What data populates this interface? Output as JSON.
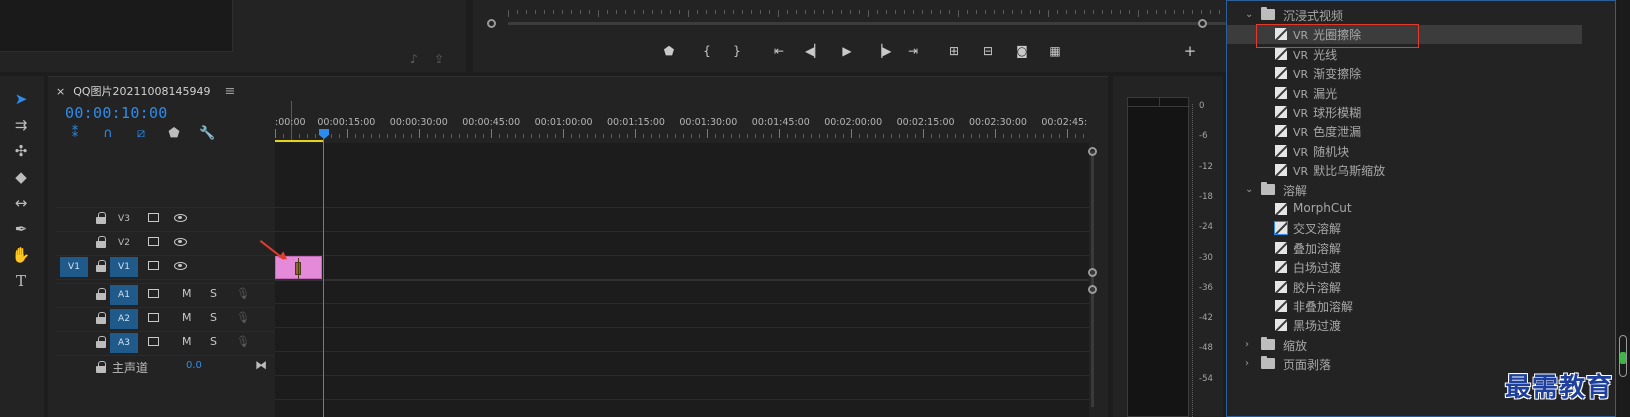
{
  "timeline": {
    "tab_close": "×",
    "tab_title": "QQ图片20211008145949",
    "tab_menu": "≡",
    "timecode": "00:00:10:00",
    "ruler_labels": [
      ":00:00",
      "00:00:15:00",
      "00:00:30:00",
      "00:00:45:00",
      "00:01:00:00",
      "00:01:15:00",
      "00:01:30:00",
      "00:01:45:00",
      "00:02:00:00",
      "00:02:15:00",
      "00:02:30:00",
      "00:02:45:"
    ],
    "video_tracks": [
      {
        "src": "",
        "name": "V3"
      },
      {
        "src": "",
        "name": "V2"
      },
      {
        "src": "V1",
        "name": "V1"
      }
    ],
    "audio_tracks": [
      {
        "name": "A1",
        "m": "M",
        "s": "S"
      },
      {
        "name": "A2",
        "m": "M",
        "s": "S"
      },
      {
        "name": "A3",
        "m": "M",
        "s": "S"
      }
    ],
    "master_label": "主声道",
    "master_value": "0.0"
  },
  "meter": {
    "labels": [
      "0",
      "-6",
      "-12",
      "-18",
      "-24",
      "-30",
      "-36",
      "-42",
      "-48",
      "-54"
    ]
  },
  "effects": {
    "folder1": "沉浸式视频",
    "vr_prefix": "VR",
    "items1": [
      "光圈擦除",
      "光线",
      "渐变擦除",
      "漏光",
      "球形模糊",
      "色度泄漏",
      "随机块",
      "默比乌斯缩放"
    ],
    "folder2": "溶解",
    "items2": [
      "MorphCut",
      "交叉溶解",
      "叠加溶解",
      "白场过渡",
      "胶片溶解",
      "非叠加溶解",
      "黑场过渡"
    ],
    "folder3": "缩放",
    "folder4": "页面剥落"
  },
  "watermark": "最需教育",
  "colors": {
    "accent": "#2d8ceb",
    "clip": "#e58ad8",
    "annotation": "#e23b2c"
  }
}
